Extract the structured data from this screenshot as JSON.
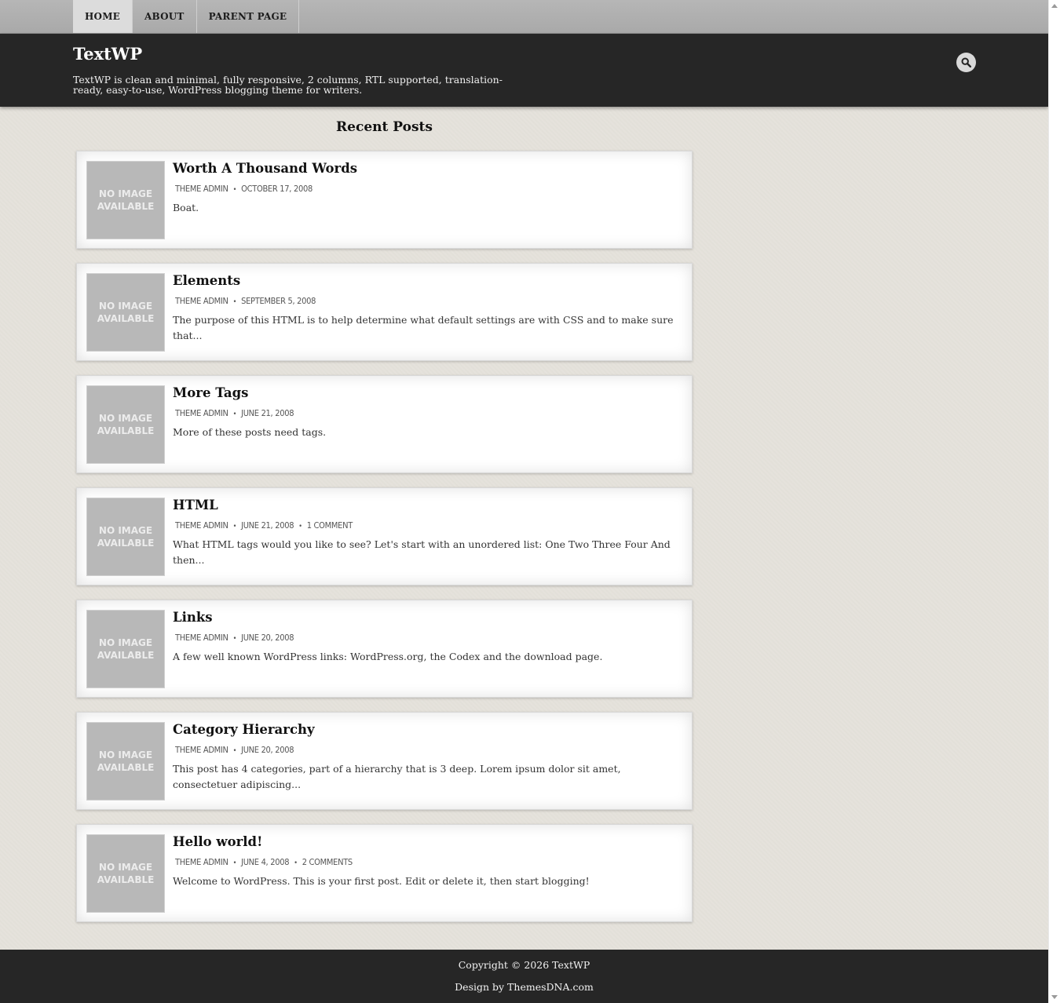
{
  "nav": {
    "items": [
      {
        "label": "HOME"
      },
      {
        "label": "ABOUT"
      },
      {
        "label": "PARENT PAGE"
      }
    ]
  },
  "header": {
    "title": "TextWP",
    "description": "TextWP is clean and minimal, fully responsive, 2 columns, RTL supported, translation-ready, easy-to-use, WordPress blogging theme for writers.",
    "search_icon": "search-icon"
  },
  "main": {
    "section_title": "Recent Posts",
    "thumb_text": [
      "NO IMAGE",
      "AVAILABLE"
    ],
    "posts": [
      {
        "title": "Worth A Thousand Words",
        "author": "THEME ADMIN",
        "date": "OCTOBER 17, 2008",
        "comments": "",
        "excerpt": "Boat."
      },
      {
        "title": "Elements",
        "author": "THEME ADMIN",
        "date": "SEPTEMBER 5, 2008",
        "comments": "",
        "excerpt": "The purpose of this HTML is to help determine what default settings are with CSS and to make sure that..."
      },
      {
        "title": "More Tags",
        "author": "THEME ADMIN",
        "date": "JUNE 21, 2008",
        "comments": "",
        "excerpt": "More of these posts need tags."
      },
      {
        "title": "HTML",
        "author": "THEME ADMIN",
        "date": "JUNE 21, 2008",
        "comments": "1 COMMENT",
        "excerpt": "What HTML tags would you like to see? Let's start with an unordered list: One Two Three Four And then..."
      },
      {
        "title": "Links",
        "author": "THEME ADMIN",
        "date": "JUNE 20, 2008",
        "comments": "",
        "excerpt": "A few well known WordPress links: WordPress.org, the Codex and the download page."
      },
      {
        "title": "Category Hierarchy",
        "author": "THEME ADMIN",
        "date": "JUNE 20, 2008",
        "comments": "",
        "excerpt": "This post has 4 categories, part of a hierarchy that is 3 deep. Lorem ipsum dolor sit amet, consectetuer adipiscing..."
      },
      {
        "title": "Hello world!",
        "author": "THEME ADMIN",
        "date": "JUNE 4, 2008",
        "comments": "2 COMMENTS",
        "excerpt": "Welcome to WordPress. This is your first post. Edit or delete it, then start blogging!"
      }
    ]
  },
  "footer": {
    "copyright": "Copyright © 2026 TextWP",
    "credit": "Design by ThemesDNA.com"
  }
}
